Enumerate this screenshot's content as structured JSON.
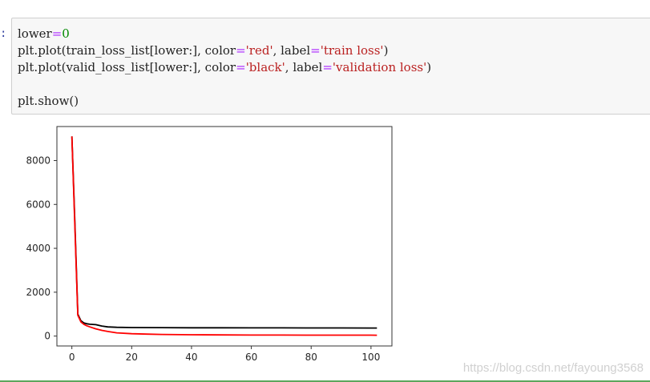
{
  "cell": {
    "prompt": ":",
    "code": {
      "line1": {
        "var": "lower",
        "eq": "=",
        "num": "0"
      },
      "line2": {
        "pre": "plt.plot(train_loss_list[lower:], color",
        "eq1": "=",
        "color_str": "'red'",
        "mid": ", label",
        "eq2": "=",
        "label_str": "'train loss'",
        "post": ")"
      },
      "line3": {
        "pre": "plt.plot(valid_loss_list[lower:], color",
        "eq1": "=",
        "color_str": "'black'",
        "mid": ", label",
        "eq2": "=",
        "label_str": "'validation loss'",
        "post": ")"
      },
      "line4": "",
      "line5": "plt.show()"
    }
  },
  "chart_data": {
    "type": "line",
    "title": "",
    "xlabel": "",
    "ylabel": "",
    "xlim": [
      -5,
      107
    ],
    "ylim": [
      -450,
      9550
    ],
    "xticks": [
      "0",
      "20",
      "40",
      "60",
      "80",
      "100"
    ],
    "yticks": [
      "0",
      "2000",
      "4000",
      "6000",
      "8000"
    ],
    "legend": "none",
    "grid": false,
    "series": [
      {
        "color": "#000000",
        "x": [
          0,
          1,
          2,
          3,
          4,
          5,
          6,
          8,
          10,
          12,
          15,
          20,
          30,
          40,
          50,
          60,
          70,
          80,
          90,
          100,
          102
        ],
        "values": [
          9100,
          5200,
          1000,
          700,
          600,
          560,
          540,
          520,
          460,
          420,
          400,
          390,
          385,
          380,
          378,
          376,
          374,
          372,
          370,
          368,
          367
        ]
      },
      {
        "color": "#ff0000",
        "x": [
          0,
          1,
          2,
          3,
          4,
          5,
          6,
          8,
          10,
          12,
          15,
          20,
          25,
          30,
          40,
          50,
          60,
          70,
          80,
          90,
          100,
          102
        ],
        "values": [
          9100,
          5000,
          950,
          650,
          540,
          470,
          420,
          330,
          260,
          210,
          150,
          110,
          90,
          75,
          60,
          52,
          48,
          45,
          43,
          42,
          41,
          40
        ]
      }
    ]
  },
  "watermark": "https://blog.csdn.net/fayoung3568"
}
